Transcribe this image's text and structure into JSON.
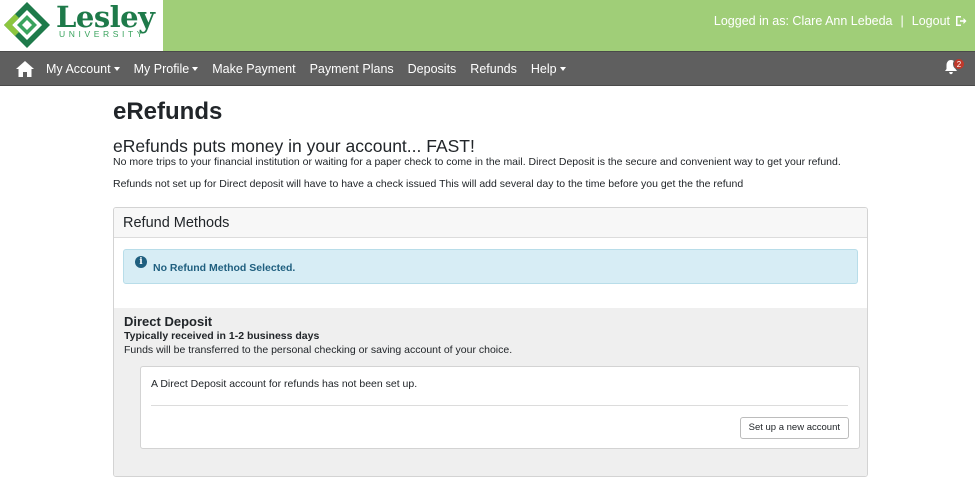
{
  "header": {
    "logo_text": "Lesley",
    "logo_subtext": "UNIVERSITY",
    "logged_in_text": "Logged in as: Clare Ann Lebeda",
    "separator": "|",
    "logout_label": "Logout",
    "brand_color": "#a0ce78",
    "logo_color": "#1e7a4a"
  },
  "nav": {
    "background": "#5f5f5f",
    "items": [
      {
        "label": "My Account",
        "dropdown": true
      },
      {
        "label": "My Profile",
        "dropdown": true
      },
      {
        "label": "Make Payment",
        "dropdown": false
      },
      {
        "label": "Payment Plans",
        "dropdown": false
      },
      {
        "label": "Deposits",
        "dropdown": false
      },
      {
        "label": "Refunds",
        "dropdown": false
      },
      {
        "label": "Help",
        "dropdown": true
      }
    ],
    "notification_count": "2",
    "icons": [
      "home-icon",
      "bell-icon"
    ]
  },
  "main": {
    "title": "eRefunds",
    "tagline": "eRefunds puts money in your account... FAST!",
    "description_1": "No more trips to your financial institution or waiting for a paper check to come in the mail. Direct Deposit is the secure and convenient way to get your refund.",
    "description_2": "Refunds not set up for Direct deposit will have to have a check issued This will add several day to the time before you get the the refund",
    "refund_methods": {
      "heading": "Refund Methods",
      "alert_text": "No Refund Method Selected.",
      "alert_color": "#d7edf5",
      "direct_deposit": {
        "title": "Direct Deposit",
        "subtitle": "Typically received in 1-2 business days",
        "description": "Funds will be transferred to the personal checking or saving account of your choice.",
        "status_text": "A Direct Deposit account for refunds has not been set up.",
        "setup_button_label": "Set up a new account"
      }
    }
  }
}
